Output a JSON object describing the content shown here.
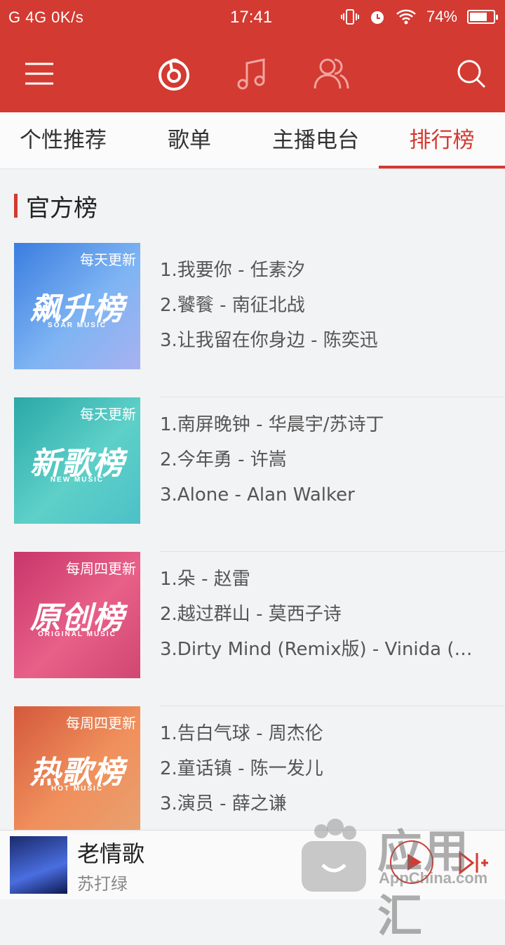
{
  "status_bar": {
    "left": "G 4G 0K/s",
    "time": "17:41",
    "battery": "74%",
    "battery_level": 0.74
  },
  "app_bar": {
    "icons": [
      "menu-icon",
      "netease-music-icon",
      "music-note-icon",
      "friends-icon",
      "search-icon"
    ],
    "accent_color": "#d33a31"
  },
  "tabs": [
    {
      "label": "个性推荐",
      "active": false
    },
    {
      "label": "歌单",
      "active": false
    },
    {
      "label": "主播电台",
      "active": false
    },
    {
      "label": "排行榜",
      "active": true
    }
  ],
  "section": {
    "title": "官方榜"
  },
  "charts": [
    {
      "name": "飙升榜",
      "subtitle": "SOAR MUSIC",
      "frequency": "每天更新",
      "songs": [
        "1.我要你 - 任素汐",
        "2.饕餮 - 南征北战",
        "3.让我留在你身边 - 陈奕迅"
      ]
    },
    {
      "name": "新歌榜",
      "subtitle": "NEW MUSIC",
      "frequency": "每天更新",
      "songs": [
        "1.南屏晚钟 - 华晨宇/苏诗丁",
        "2.今年勇 - 许嵩",
        "3.Alone - Alan Walker"
      ]
    },
    {
      "name": "原创榜",
      "subtitle": "ORIGINAL MUSIC",
      "frequency": "每周四更新",
      "songs": [
        "1.朵 - 赵雷",
        "2.越过群山 - 莫西子诗",
        "3.Dirty Mind (Remix版) - Vinida (…"
      ]
    },
    {
      "name": "热歌榜",
      "subtitle": "HOT MUSIC",
      "frequency": "每周四更新",
      "songs": [
        "1.告白气球 - 周杰伦",
        "2.童话镇 - 陈一发儿",
        "3.演员 - 薛之谦"
      ]
    }
  ],
  "player": {
    "title": "老情歌",
    "artist": "苏打绿"
  },
  "watermark": {
    "cn": "应用汇",
    "en": "AppChina.com"
  }
}
